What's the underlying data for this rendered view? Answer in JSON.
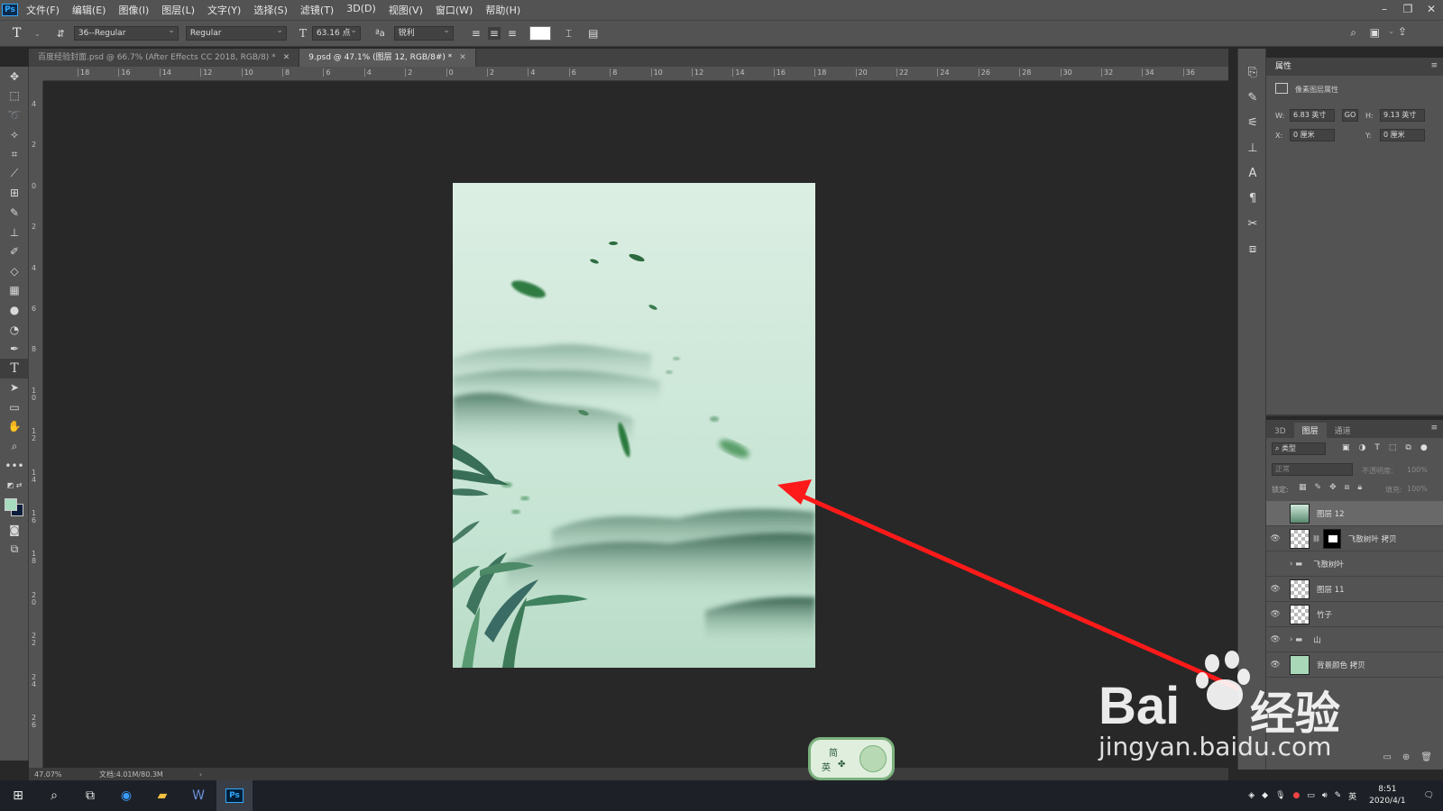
{
  "menubar": {
    "items": [
      "文件(F)",
      "编辑(E)",
      "图像(I)",
      "图层(L)",
      "文字(Y)",
      "选择(S)",
      "滤镜(T)",
      "3D(D)",
      "视图(V)",
      "窗口(W)",
      "帮助(H)"
    ],
    "logo": "Ps"
  },
  "options": {
    "font_family": "36--Regular",
    "font_style": "Regular",
    "font_size": "63.16 点",
    "antialias": "锐利"
  },
  "tabs": [
    {
      "label": "百度经验封面.psd @ 66.7% (After Effects CC 2018, RGB/8) *",
      "active": false
    },
    {
      "label": "9.psd @ 47.1% (图层 12, RGB/8#) *",
      "active": true
    }
  ],
  "ruler_h_labels": [
    "18",
    "16",
    "14",
    "12",
    "10",
    "8",
    "6",
    "4",
    "2",
    "0",
    "2",
    "4",
    "6",
    "8",
    "10",
    "12",
    "14",
    "16",
    "18",
    "20",
    "22",
    "24",
    "26",
    "28",
    "30",
    "32",
    "34",
    "36"
  ],
  "ruler_v_labels": [
    "4",
    "2",
    "0",
    "2",
    "4",
    "6",
    "8",
    "1\n0",
    "1\n2",
    "1\n4",
    "1\n6",
    "1\n8",
    "2\n0",
    "2\n2",
    "2\n4",
    "2\n6"
  ],
  "status": {
    "zoom": "47.07%",
    "doc": "文档:4.01M/80.3M"
  },
  "properties": {
    "title": "属性",
    "subtitle": "像素图层属性",
    "w_label": "W:",
    "w_value": "6.83 英寸",
    "h_label": "H:",
    "h_value": "9.13 英寸",
    "x_label": "X:",
    "x_value": "0 厘米",
    "y_label": "Y:",
    "y_value": "0 厘米",
    "link": "GO"
  },
  "layers_panel": {
    "tabs": [
      "3D",
      "图层",
      "通道"
    ],
    "active_tab": "图层",
    "filter": "类型",
    "blend": "正常",
    "opacity_label": "不透明度:",
    "opacity_value": "100%",
    "lock_label": "锁定:",
    "fill_label": "填充:",
    "fill_value": "100%",
    "layers": [
      {
        "name": "图层 12",
        "visible": false,
        "type": "pixel-green",
        "selected": true
      },
      {
        "name": "飞散树叶 拷贝",
        "visible": true,
        "type": "masked"
      },
      {
        "name": "飞散树叶",
        "visible": false,
        "type": "group"
      },
      {
        "name": "图层 11",
        "visible": true,
        "type": "pixel"
      },
      {
        "name": "竹子",
        "visible": true,
        "type": "pixel"
      },
      {
        "name": "山",
        "visible": true,
        "type": "group"
      },
      {
        "name": "背景颜色 拷贝",
        "visible": true,
        "type": "solid"
      }
    ]
  },
  "taskbar": {
    "time": "8:51",
    "date": "2020/4/1",
    "ime_lang": "英",
    "ime_badge_top": "简",
    "ime_badge_bottom": "英"
  },
  "watermark": {
    "brand": "Bai",
    "brand_cn": "经验",
    "url": "jingyan.baidu.com"
  },
  "colors": {
    "arrow": "#ff1a1a",
    "accent": "#31a8ff"
  }
}
